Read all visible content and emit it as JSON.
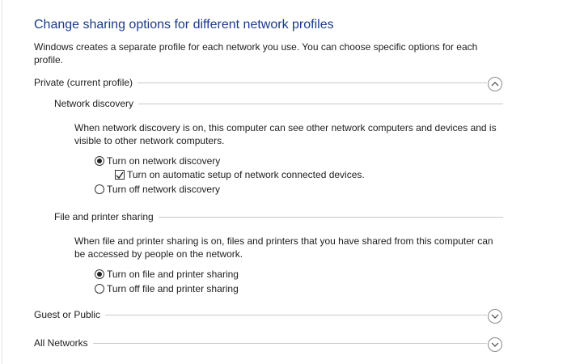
{
  "title": "Change sharing options for different network profiles",
  "intro": "Windows creates a separate profile for each network you use. You can choose specific options for each profile.",
  "profiles": {
    "private": {
      "label": "Private (current profile)",
      "state": "expanded"
    },
    "guest": {
      "label": "Guest or Public",
      "state": "collapsed"
    },
    "all": {
      "label": "All Networks",
      "state": "collapsed"
    }
  },
  "network_discovery": {
    "heading": "Network discovery",
    "description": "When network discovery is on, this computer can see other network computers and devices and is visible to other network computers.",
    "on_label": "Turn on network discovery",
    "auto_setup_label": "Turn on automatic setup of network connected devices.",
    "off_label": "Turn off network discovery",
    "selected": "on",
    "auto_setup_checked": true
  },
  "file_printer": {
    "heading": "File and printer sharing",
    "description": "When file and printer sharing is on, files and printers that you have shared from this computer can be accessed by people on the network.",
    "on_label": "Turn on file and printer sharing",
    "off_label": "Turn off file and printer sharing",
    "selected": "on"
  }
}
